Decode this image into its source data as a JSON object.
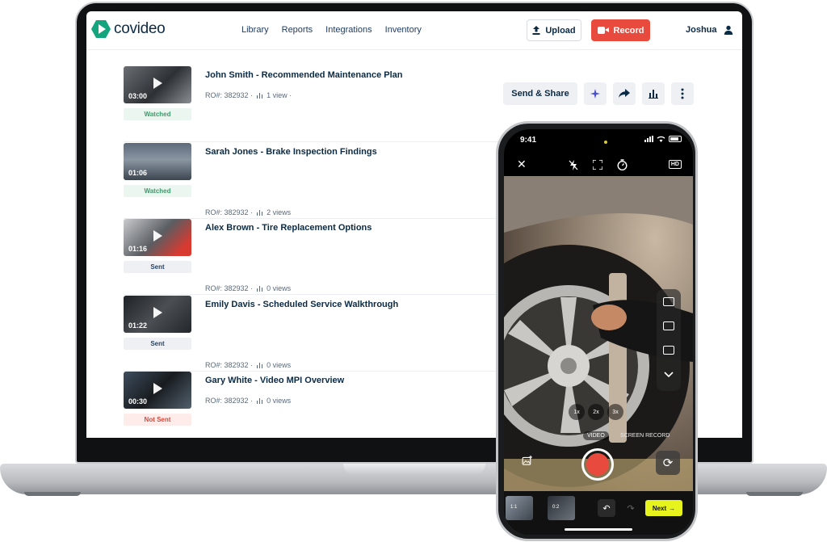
{
  "app": {
    "logo_text": "covideo",
    "nav": [
      "Library",
      "Reports",
      "Integrations",
      "Inventory"
    ],
    "upload_label": "Upload",
    "record_label": "Record",
    "user_name": "Joshua"
  },
  "actions": {
    "send_share_label": "Send & Share",
    "icons": [
      "sparkle-icon",
      "share-arrow-icon",
      "analytics-icon",
      "more-vertical-icon"
    ]
  },
  "videos": [
    {
      "title": "John Smith - Recommended Maintenance Plan",
      "duration": "03:00",
      "ro": "RO#: 382932",
      "views": "1 view",
      "status": "Watched"
    },
    {
      "title": "Sarah Jones - Brake Inspection Findings",
      "duration": "01:06",
      "ro": "RO#: 382932",
      "views": "2 views",
      "status": "Watched"
    },
    {
      "title": "Alex Brown - Tire Replacement Options",
      "duration": "01:16",
      "ro": "RO#: 382932",
      "views": "0 views",
      "status": "Sent"
    },
    {
      "title": "Emily Davis - Scheduled Service Walkthrough",
      "duration": "01:22",
      "ro": "RO#: 382932",
      "views": "0 views",
      "status": "Sent"
    },
    {
      "title": "Gary White - Video MPI Overview",
      "duration": "00:30",
      "ro": "RO#: 382932",
      "views": "0 views",
      "status": "Not Sent"
    }
  ],
  "meta_separator": "·",
  "phone": {
    "time": "9:41",
    "hd_label": "HD",
    "zoom_levels": [
      "1x",
      "2x",
      "3x"
    ],
    "mode_video": "VIDEO",
    "mode_screen": "SCREEN RECORD",
    "next_label": "Next",
    "clip_labels": [
      "1:1",
      "0:2"
    ]
  },
  "colors": {
    "brand_green": "#14a47e",
    "record_red": "#e84a3d",
    "navy": "#0b2a44",
    "next_yellow": "#e6f31c"
  }
}
